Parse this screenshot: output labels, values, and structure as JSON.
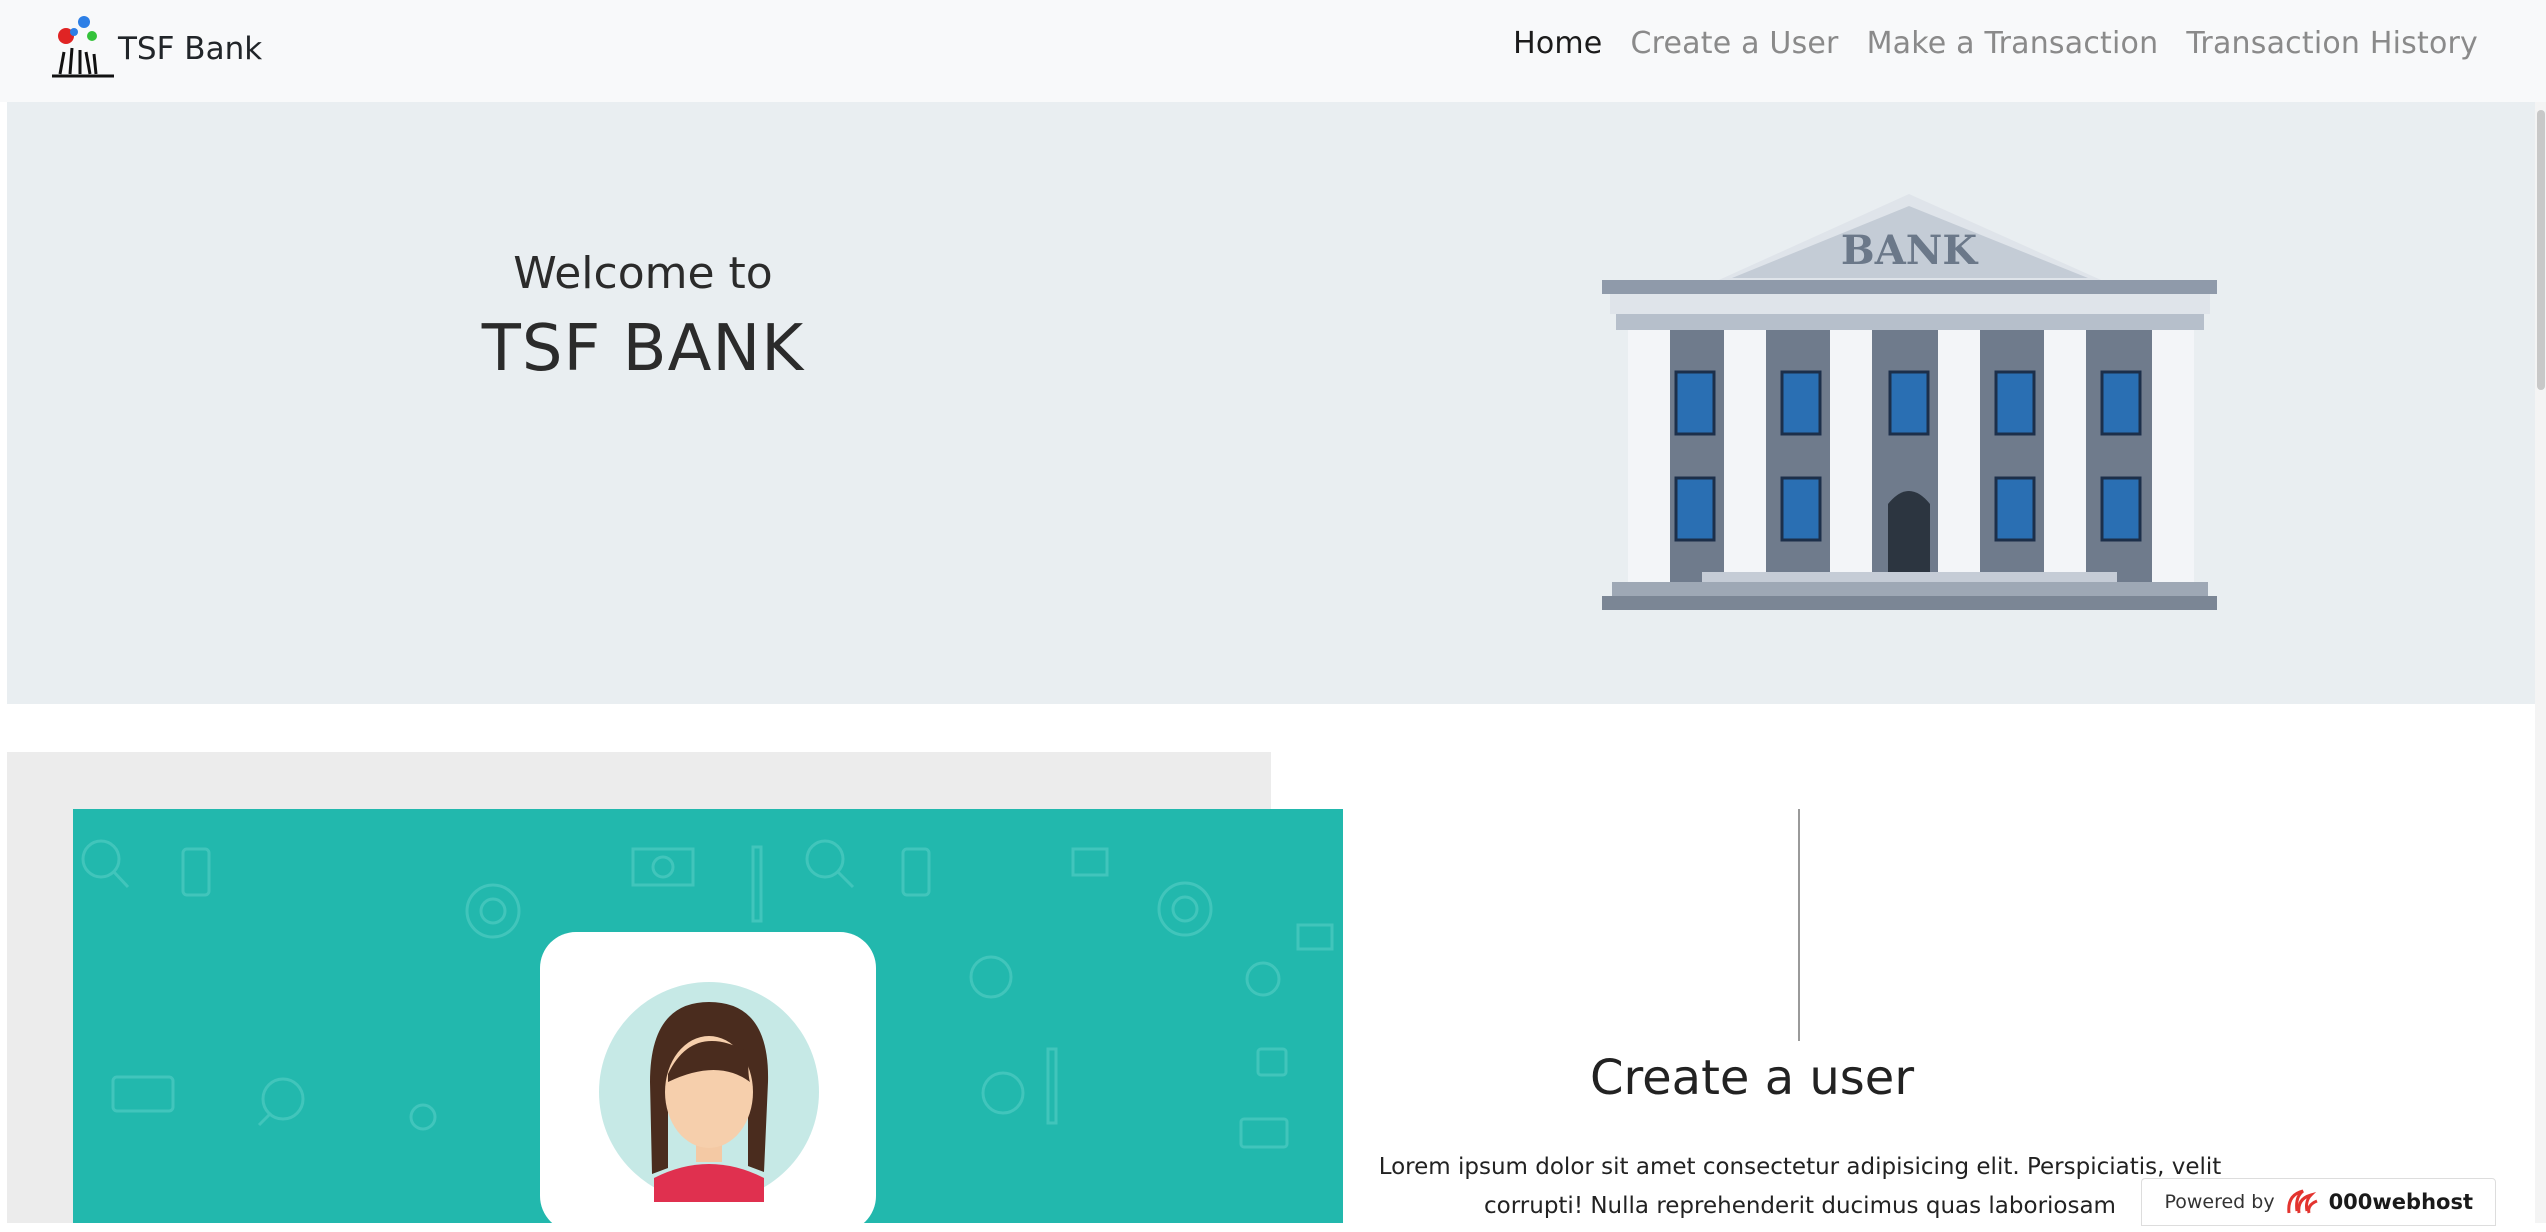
{
  "navbar": {
    "brand": "TSF Bank",
    "links": [
      {
        "label": "Home",
        "active": true
      },
      {
        "label": "Create a User",
        "active": false
      },
      {
        "label": "Make a Transaction",
        "active": false
      },
      {
        "label": "Transaction History",
        "active": false
      }
    ]
  },
  "hero": {
    "welcome": "Welcome to",
    "title": "TSF BANK",
    "illustration_sign": "BANK"
  },
  "feature": {
    "heading": "Create a user",
    "text": "Lorem ipsum dolor sit amet consectetur adipisicing elit. Perspiciatis, velit corrupti! Nulla reprehenderit ducimus quas laboriosam"
  },
  "footer_badge": {
    "powered_label": "Powered by",
    "host_name": "000webhost"
  },
  "colors": {
    "hero_bg": "#e9eef1",
    "teal": "#22b8ad",
    "navbar_bg": "#f8f9fa"
  },
  "icons": [
    "bank-logo-icon",
    "bank-building-illustration",
    "user-avatar-icon",
    "webhost-logo-icon"
  ]
}
